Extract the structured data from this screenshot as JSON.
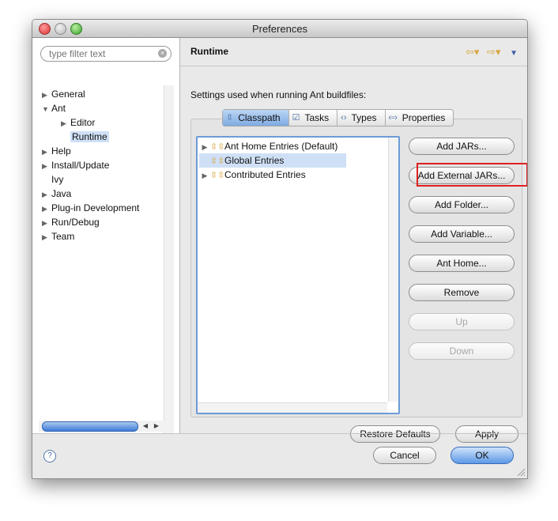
{
  "window": {
    "title": "Preferences"
  },
  "sidebar": {
    "filter_placeholder": "type filter text",
    "items": [
      {
        "label": "General",
        "arrow": "▶"
      },
      {
        "label": "Ant",
        "arrow": "▼"
      },
      {
        "label": "Editor",
        "arrow": "▶"
      },
      {
        "label": "Runtime",
        "arrow": ""
      },
      {
        "label": "Help",
        "arrow": "▶"
      },
      {
        "label": "Install/Update",
        "arrow": "▶"
      },
      {
        "label": "Ivy",
        "arrow": ""
      },
      {
        "label": "Java",
        "arrow": "▶"
      },
      {
        "label": "Plug-in Development",
        "arrow": "▶"
      },
      {
        "label": "Run/Debug",
        "arrow": "▶"
      },
      {
        "label": "Team",
        "arrow": "▶"
      }
    ],
    "selected": "Runtime"
  },
  "main": {
    "title": "Runtime",
    "description": "Settings used when running Ant buildfiles:",
    "tabs": [
      {
        "label": "Classpath",
        "icon": "classpath-icon",
        "active": true
      },
      {
        "label": "Tasks",
        "icon": "tasks-icon",
        "active": false
      },
      {
        "label": "Types",
        "icon": "types-icon",
        "active": false
      },
      {
        "label": "Properties",
        "icon": "properties-icon",
        "active": false
      }
    ],
    "entries": [
      {
        "label": "Ant Home Entries (Default)",
        "arrow": "▶",
        "selected": false
      },
      {
        "label": "Global Entries",
        "arrow": "",
        "selected": true
      },
      {
        "label": "Contributed Entries",
        "arrow": "▶",
        "selected": false
      }
    ],
    "buttons": {
      "add_jars": "Add JARs...",
      "add_external_jars": "Add External JARs...",
      "add_folder": "Add Folder...",
      "add_variable": "Add Variable...",
      "ant_home": "Ant Home...",
      "remove": "Remove",
      "up": "Up",
      "down": "Down"
    },
    "restore_defaults": "Restore Defaults",
    "apply": "Apply"
  },
  "footer": {
    "help": "?",
    "cancel": "Cancel",
    "ok": "OK"
  },
  "colors": {
    "highlight_box": "#e02020",
    "selection": "#cfe0f6",
    "accent": "#5d98e6"
  }
}
